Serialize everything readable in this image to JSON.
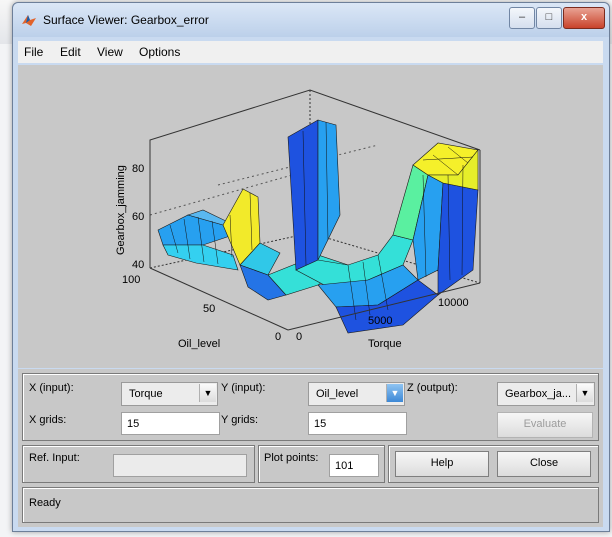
{
  "window": {
    "title": "Surface Viewer: Gearbox_error",
    "controls": {
      "minimize": "–",
      "maximize": "□",
      "close": "x"
    }
  },
  "menu": [
    "File",
    "Edit",
    "View",
    "Options"
  ],
  "plot": {
    "z_label": "Gearbox_jamming",
    "x_label": "Torque",
    "y_label": "Oil_level",
    "z_ticks": [
      "80",
      "60",
      "40"
    ],
    "y_ticks": [
      "100",
      "50",
      "0"
    ],
    "x_ticks": [
      "0",
      "5000",
      "10000"
    ],
    "colormap": [
      "#1e52e0",
      "#27a0f0",
      "#34e0e0",
      "#5af0a0",
      "#f5f02a"
    ]
  },
  "controls": {
    "x_input_label": "X (input):",
    "x_input_value": "Torque",
    "y_input_label": "Y (input):",
    "y_input_value": "Oil_level",
    "z_output_label": "Z (output):",
    "z_output_value": "Gearbox_ja...",
    "x_grids_label": "X grids:",
    "x_grids_value": "15",
    "y_grids_label": "Y grids:",
    "y_grids_value": "15",
    "evaluate_label": "Evaluate",
    "ref_input_label": "Ref. Input:",
    "ref_input_value": "",
    "plot_points_label": "Plot points:",
    "plot_points_value": "101",
    "help_label": "Help",
    "close_label": "Close"
  },
  "status": "Ready"
}
